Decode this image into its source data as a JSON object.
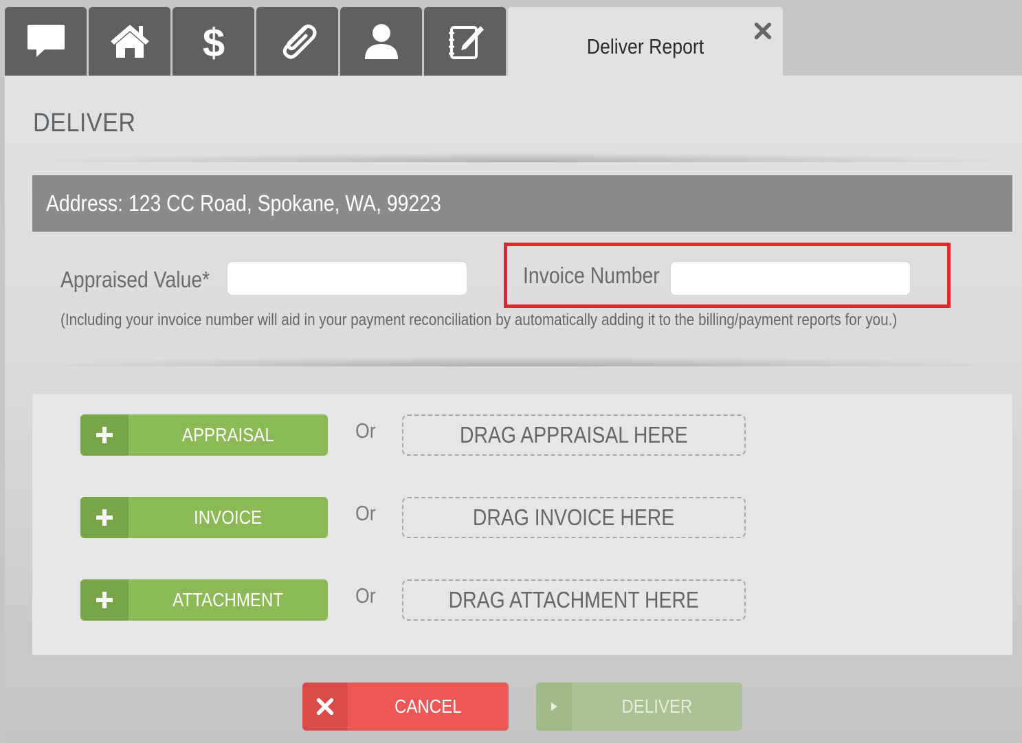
{
  "tabs": {
    "icons": [
      "chat-icon",
      "home-icon",
      "dollar-icon",
      "paperclip-icon",
      "user-icon",
      "notepad-pen-icon"
    ],
    "active_title": "Deliver Report"
  },
  "page": {
    "heading": "DELIVER",
    "address": "Address: 123 CC Road, Spokane, WA, 99223"
  },
  "form": {
    "appraised_value_label": "Appraised Value*",
    "appraised_value": "",
    "invoice_number_label": "Invoice Number",
    "invoice_number": "",
    "help_text": "(Including your invoice number will aid in your payment reconciliation by automatically adding it to the billing/payment reports for you.)"
  },
  "uploads": [
    {
      "button": "APPRAISAL",
      "or": "Or",
      "drop": "DRAG APPRAISAL HERE"
    },
    {
      "button": "INVOICE",
      "or": "Or",
      "drop": "DRAG INVOICE HERE"
    },
    {
      "button": "ATTACHMENT",
      "or": "Or",
      "drop": "DRAG ATTACHMENT HERE"
    }
  ],
  "actions": {
    "cancel": "CANCEL",
    "deliver": "DELIVER"
  },
  "colors": {
    "accent_green": "#8bb956",
    "cancel_red": "#ed5755",
    "highlight_red": "#e8222a"
  }
}
